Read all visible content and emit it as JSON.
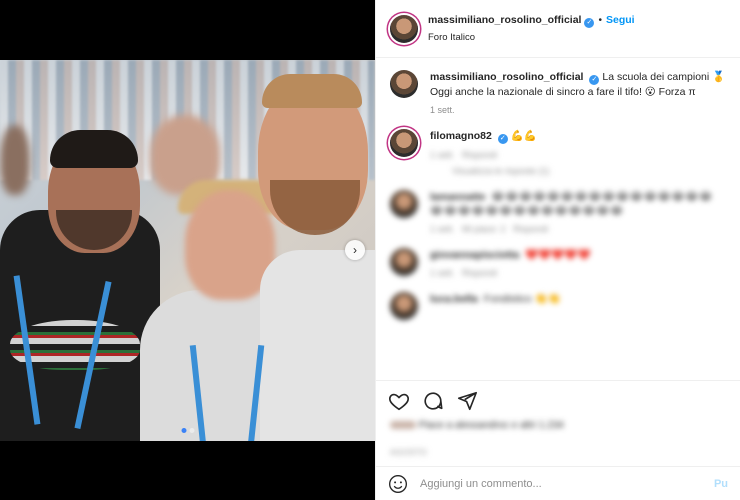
{
  "post": {
    "author": "massimiliano_rosolino_official",
    "follow_label": "Segui",
    "bullet": "•",
    "location": "Foro Italico",
    "caption_line1": "La scuola dei campioni 🥇",
    "caption_line2": "Oggi anche la nazionale di sincro a fare il tifo! 😮 Forza π",
    "caption_time": "1 sett.",
    "next_arrow": "›"
  },
  "comments": [
    {
      "user": "filomagno82",
      "text": "💪💪",
      "meta1": "1 sett.",
      "meta2": "Rispondi",
      "replies": "Visualizza le risposte (1)"
    },
    {
      "user": "lamannatte",
      "text": "😂😂😂😂😂😂😂😂😂😂😂😂😂😂😂😂😂😂😂😂😂😂😂😂😂😂😂😂😂😂",
      "meta1": "1 sett.",
      "meta2": "Mi piace: 2",
      "meta3": "Rispondi"
    },
    {
      "user": "giovannapisciotta",
      "text": "❤️❤️❤️❤️❤️",
      "meta1": "1 sett.",
      "meta2": "Rispondi"
    },
    {
      "user": "luca.bella",
      "text": "Fondistico 👏👏",
      "meta1": "",
      "meta2": ""
    }
  ],
  "likes_text": "Piace a alessandroc e altri 1.234",
  "date_text": "AGOSTO",
  "add_comment": {
    "placeholder": "Aggiungi un commento...",
    "publish": "Pu"
  },
  "colors": {
    "accent": "#0095f6",
    "verified": "#3897f0",
    "carousel_active": "#3b82f6"
  }
}
